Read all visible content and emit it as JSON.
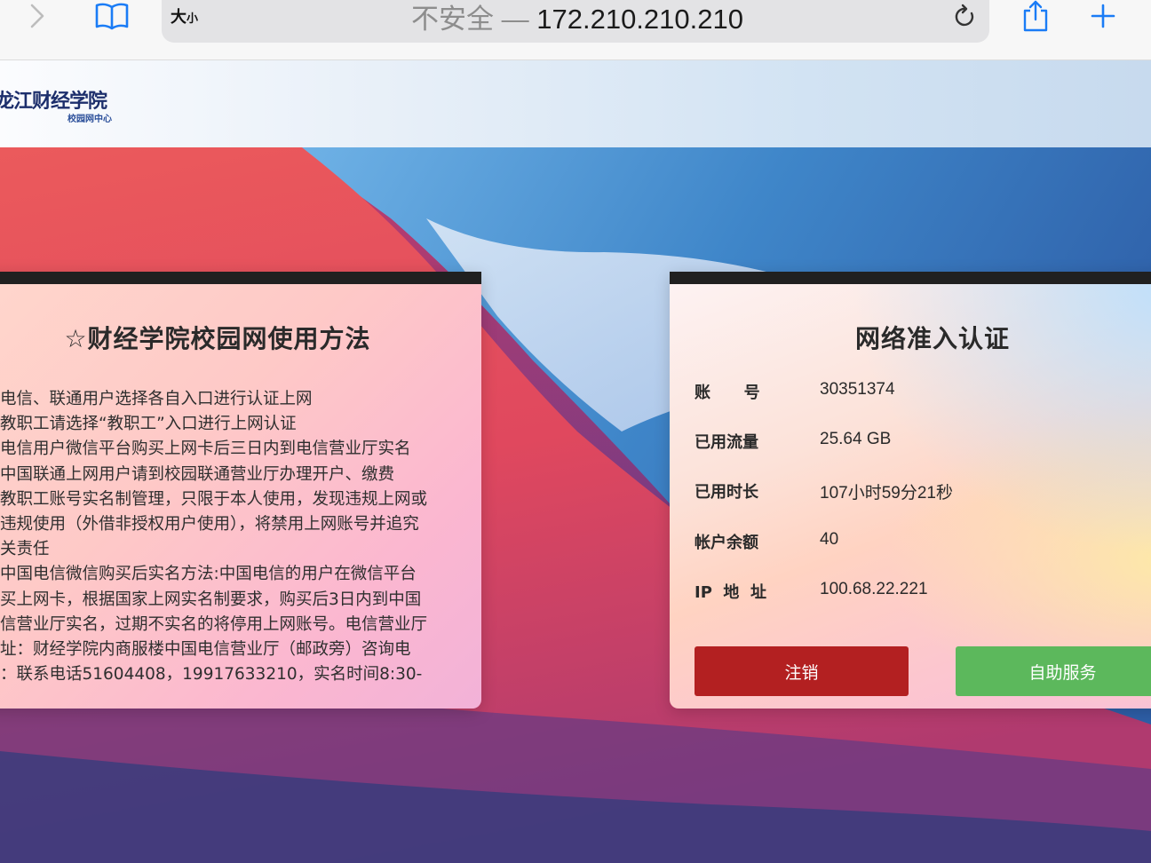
{
  "browser": {
    "text_size_label_large": "大",
    "text_size_label_small": "小",
    "url_insecure_label": "不安全 — ",
    "url_host": "172.210.210.210",
    "icons": [
      "chevron-right-icon",
      "book-icon",
      "reload-icon",
      "share-icon",
      "plus-icon"
    ],
    "accent_color": "#1a7cf6"
  },
  "header": {
    "school_name": "龙江财经学院",
    "sub_title": "校园网中心"
  },
  "left_panel": {
    "title": "☆财经学院校园网使用方法",
    "lines": [
      "电信、联通用户选择各自入口进行认证上网",
      "教职工请选择“教职工”入口进行上网认证",
      "电信用户微信平台购买上网卡后三日内到电信营业厅实名",
      "中国联通上网用户请到校园联通营业厅办理开户、缴费",
      "教职工账号实名制管理，只限于本人使用，发现违规上网或",
      "违规使用（外借非授权用户使用），将禁用上网账号并追究",
      "关责任",
      "中国电信微信购买后实名方法:中国电信的用户在微信平台",
      "买上网卡，根据国家上网实名制要求，购买后3日内到中国",
      "信营业厅实名，过期不实名的将停用上网账号。电信营业厅",
      "址：财经学院内商服楼中国电信营业厅（邮政旁）咨询电",
      "：联系电话51604408，19917633210，实名时间8:30-"
    ]
  },
  "auth_panel": {
    "title": "网络准入认证",
    "rows": [
      {
        "label": "账      号",
        "value": "30351374"
      },
      {
        "label": "已用流量",
        "value": "25.64 GB"
      },
      {
        "label": "已用时长",
        "value": "107小时59分21秒"
      },
      {
        "label": "帐户余额",
        "value": "40"
      },
      {
        "label": "IP  地  址",
        "value": "100.68.22.221"
      }
    ],
    "logout_label": "注销",
    "self_service_label": "自助服务",
    "logout_color": "#b32021",
    "self_service_color": "#5cb85c"
  }
}
